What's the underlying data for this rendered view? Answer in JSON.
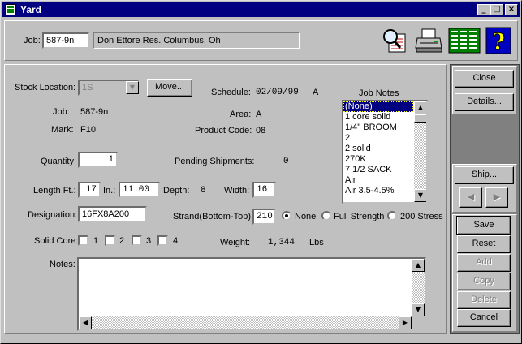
{
  "window": {
    "title": "Yard",
    "minimize": "_",
    "maximize": "□",
    "close": "×"
  },
  "header": {
    "job_label": "Job:",
    "job_value": "587-9n",
    "job_desc": "Don Ettore Res. Columbus, Oh",
    "icons": [
      "search-document-icon",
      "printer-icon",
      "spreadsheet-icon",
      "help-icon"
    ]
  },
  "form": {
    "stock_location_label": "Stock Location:",
    "stock_location_value": "1S",
    "move_button": "Move...",
    "schedule_label": "Schedule:",
    "schedule_date": "02/09/99",
    "schedule_code": "A",
    "job_label": "Job:",
    "job_value": "587-9n",
    "area_label": "Area:",
    "area_value": "A",
    "mark_label": "Mark:",
    "mark_value": "F10",
    "product_code_label": "Product Code:",
    "product_code_value": "08",
    "quantity_label": "Quantity:",
    "quantity_value": "1",
    "pending_label": "Pending Shipments:",
    "pending_value": "0",
    "length_ft_label": "Length Ft.:",
    "length_ft_value": "17",
    "length_in_label": "In.:",
    "length_in_value": "11.00",
    "depth_label": "Depth:",
    "depth_value": "8",
    "width_label": "Width:",
    "width_value": "16",
    "designation_label": "Designation:",
    "designation_value": "16FX8A200",
    "strand_label": "Strand(Bottom-Top):",
    "strand_value": "210",
    "strand_options": [
      "None",
      "Full Strength",
      "200 Stress"
    ],
    "solid_core_label": "Solid Core:",
    "solid_core_options": [
      "1",
      "2",
      "3",
      "4"
    ],
    "weight_label": "Weight:",
    "weight_value": "1,344",
    "weight_unit": "Lbs",
    "notes_label": "Notes:",
    "notes_value": ""
  },
  "job_notes": {
    "title": "Job Notes",
    "items": [
      "(None)",
      "1 core solid",
      "1/4\" BROOM",
      "2",
      "2 solid",
      "270K",
      "7 1/2 SACK",
      "Air",
      "Air 3.5-4.5%"
    ],
    "selected": 0
  },
  "side_buttons": {
    "close": "Close",
    "details": "Details...",
    "ship": "Ship...",
    "prev": "◀",
    "next": "▶",
    "save": "Save",
    "reset": "Reset",
    "add": "Add",
    "copy": "Copy",
    "delete": "Delete",
    "cancel": "Cancel"
  }
}
